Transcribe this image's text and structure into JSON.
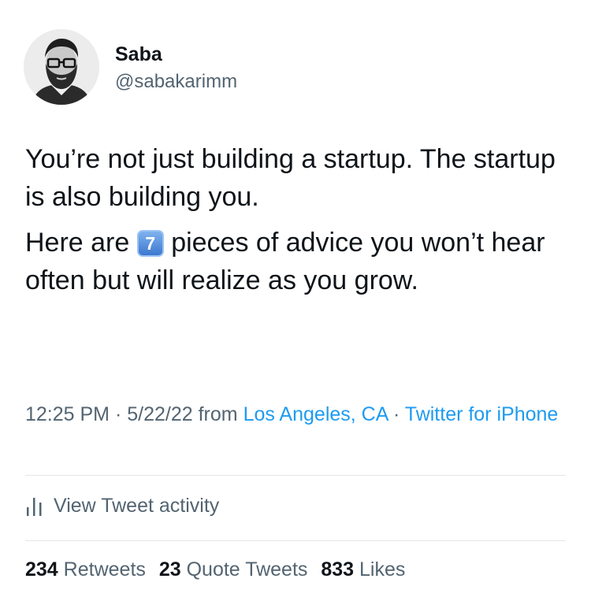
{
  "author": {
    "display_name": "Saba",
    "handle": "@sabakarimm",
    "avatar_icon": "avatar-illustration"
  },
  "tweet": {
    "paragraph1": "You’re not just building a startup. The startup is also building you.",
    "paragraph2_before": "Here are",
    "keycap_emoji": "7",
    "paragraph2_after": "pieces of advice you won’t hear often but will realize as you grow."
  },
  "meta": {
    "time": "12:25 PM",
    "sep1": " · ",
    "date": "5/22/22",
    "from_word": " from ",
    "location": "Los Angeles, CA",
    "sep2": " · ",
    "source": "Twitter for iPhone"
  },
  "activity": {
    "label": "View Tweet activity",
    "icon": "bar-chart-icon"
  },
  "stats": {
    "retweets_count": "234",
    "retweets_label": "Retweets",
    "quotes_count": "23",
    "quotes_label": "Quote Tweets",
    "likes_count": "833",
    "likes_label": "Likes"
  },
  "colors": {
    "link": "#1d9bf0",
    "secondary_text": "#536471",
    "primary_text": "#0f1419",
    "divider": "#e3e6e8"
  }
}
